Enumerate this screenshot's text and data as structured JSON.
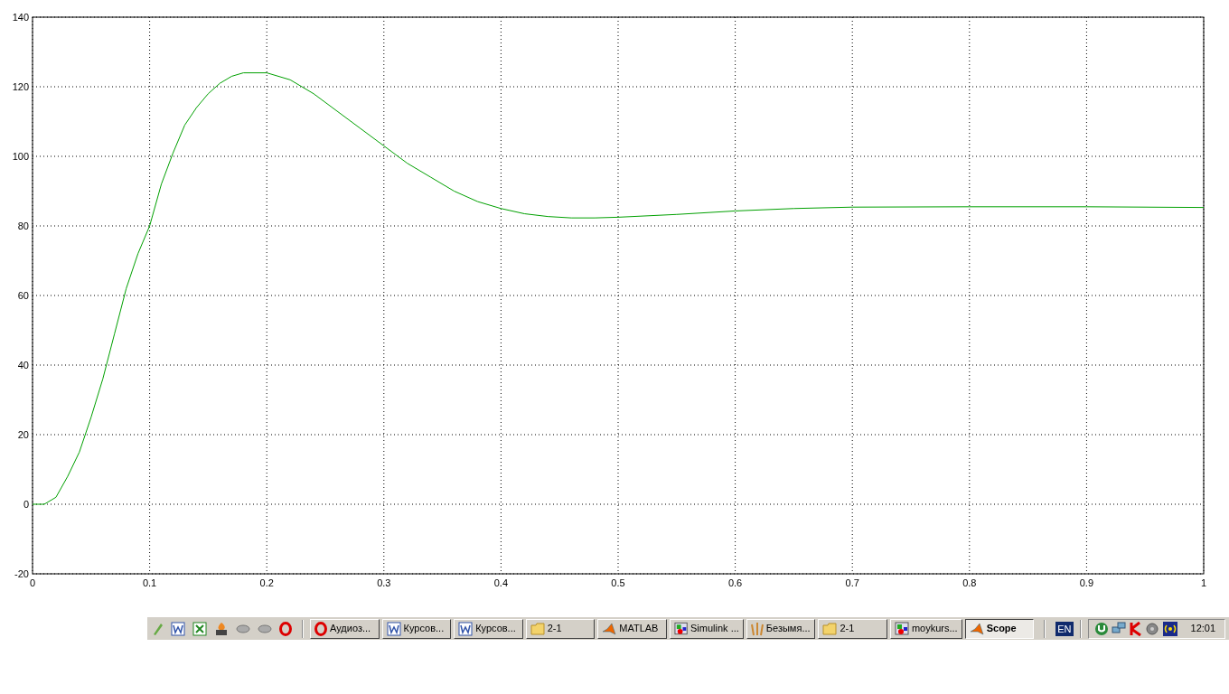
{
  "plot": {
    "chart_data": {
      "type": "line",
      "x": [
        0,
        0.01,
        0.02,
        0.03,
        0.04,
        0.05,
        0.06,
        0.07,
        0.08,
        0.09,
        0.1,
        0.11,
        0.12,
        0.13,
        0.14,
        0.15,
        0.16,
        0.17,
        0.18,
        0.2,
        0.22,
        0.24,
        0.26,
        0.28,
        0.3,
        0.32,
        0.34,
        0.36,
        0.38,
        0.4,
        0.42,
        0.44,
        0.46,
        0.48,
        0.5,
        0.55,
        0.6,
        0.65,
        0.7,
        0.8,
        0.9,
        1.0
      ],
      "grid": true,
      "series": [
        {
          "color": "#00a000",
          "values": [
            0,
            0,
            2,
            8,
            15,
            25,
            36,
            49,
            62,
            72,
            80,
            92,
            101,
            109,
            114,
            118,
            121,
            123,
            124,
            124,
            122,
            118,
            113,
            108,
            103,
            98,
            94,
            90,
            87,
            85,
            83.5,
            82.7,
            82.3,
            82.3,
            82.5,
            83.3,
            84.3,
            85,
            85.4,
            85.5,
            85.5,
            85.3
          ]
        }
      ],
      "xlim": [
        0,
        1
      ],
      "ylim": [
        -20,
        140
      ],
      "xticks": [
        {
          "value": 0,
          "label": "0"
        },
        {
          "value": 0.1,
          "label": "0.1"
        },
        {
          "value": 0.2,
          "label": "0.2"
        },
        {
          "value": 0.3,
          "label": "0.3"
        },
        {
          "value": 0.4,
          "label": "0.4"
        },
        {
          "value": 0.5,
          "label": "0.5"
        },
        {
          "value": 0.6,
          "label": "0.6"
        },
        {
          "value": 0.7,
          "label": "0.7"
        },
        {
          "value": 0.8,
          "label": "0.8"
        },
        {
          "value": 0.9,
          "label": "0.9"
        },
        {
          "value": 1,
          "label": "1"
        }
      ],
      "yticks": [
        -20,
        0,
        20,
        40,
        60,
        80,
        100,
        120,
        140
      ]
    }
  },
  "taskbar": {
    "quick_launch": [
      {
        "kind": "pen"
      },
      {
        "kind": "word"
      },
      {
        "kind": "excel"
      },
      {
        "kind": "burner"
      },
      {
        "kind": "drive"
      },
      {
        "kind": "drive"
      },
      {
        "kind": "opera"
      }
    ],
    "tasks": [
      {
        "label": "Аудиоз...",
        "kind": "opera",
        "selected": false
      },
      {
        "label": "Курсов...",
        "kind": "word",
        "selected": false
      },
      {
        "label": "Курсов...",
        "kind": "word",
        "selected": false
      },
      {
        "label": "2-1",
        "kind": "folder",
        "selected": false
      },
      {
        "label": "MATLAB",
        "kind": "matlab",
        "selected": false
      },
      {
        "label": "Simulink ...",
        "kind": "simulink",
        "selected": false
      },
      {
        "label": "Безымя...",
        "kind": "paint",
        "selected": false
      },
      {
        "label": "2-1",
        "kind": "folder",
        "selected": false
      },
      {
        "label": "moykurs...",
        "kind": "simulink",
        "selected": false
      },
      {
        "label": "Scope",
        "kind": "matlab",
        "selected": true
      }
    ],
    "language": "EN",
    "tray": [
      {
        "kind": "torrent"
      },
      {
        "kind": "network"
      },
      {
        "kind": "antivirus"
      },
      {
        "kind": "speaker"
      },
      {
        "kind": "wireless"
      }
    ],
    "clock": "12:01"
  }
}
